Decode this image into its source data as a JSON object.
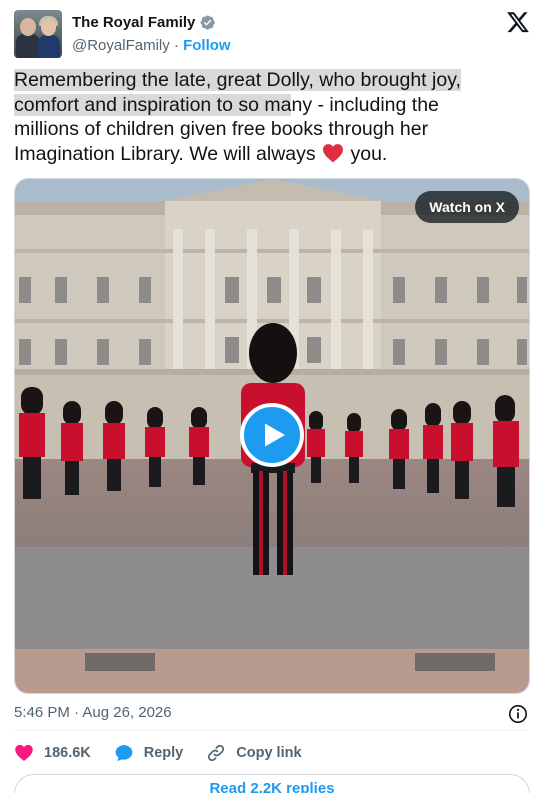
{
  "post": {
    "author_name": "The Royal Family",
    "author_handle": "@RoyalFamily",
    "separator": " · ",
    "follow_label": "Follow",
    "text_highlight_1": "Remembering the late, great Dolly, who brought joy,",
    "text_highlight_2": "comfort and inspiration to so ma",
    "text_rest_1": "ny - including the millions of children given free books through her Imagination Library. We will always ",
    "text_rest_2": " you.",
    "emoji": "red-heart",
    "timestamp": "5:46 PM · Aug 26, 2026"
  },
  "media": {
    "watch_label": "Watch on X",
    "type": "video"
  },
  "actions": {
    "like_count": "186.6K",
    "reply_label": "Reply",
    "copy_label": "Copy link"
  },
  "replies_label": "Read 2.2K replies",
  "icons": {
    "verified": "verified-badge-icon",
    "logo": "x-logo-icon",
    "info": "info-icon",
    "like": "heart-icon",
    "reply": "reply-bubble-icon",
    "copy": "link-icon",
    "play": "play-icon"
  },
  "colors": {
    "accent": "#1d9bf0",
    "like": "#f91880",
    "text_secondary": "#536471",
    "border": "#cfd9de"
  }
}
